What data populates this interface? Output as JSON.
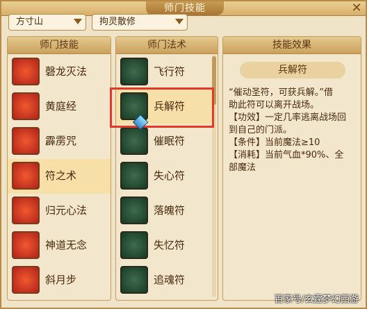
{
  "window": {
    "title": "师门技能",
    "close_label": "✕"
  },
  "filters": {
    "sect_value": "方寸山",
    "subskill_value": "拘灵散修"
  },
  "skills_panel": {
    "header": "师门技能",
    "items": [
      {
        "label": "磬龙灭法",
        "icon": "dragon-seal-icon"
      },
      {
        "label": "黄庭经",
        "icon": "book-icon"
      },
      {
        "label": "霹雳咒",
        "icon": "thunder-icon"
      },
      {
        "label": "符之术",
        "icon": "talisman-icon",
        "selected": true
      },
      {
        "label": "归元心法",
        "icon": "core-icon"
      },
      {
        "label": "神道无念",
        "icon": "shrine-icon"
      },
      {
        "label": "斜月步",
        "icon": "crescent-step-icon"
      }
    ]
  },
  "spells_panel": {
    "header": "师门法术",
    "items": [
      {
        "label": "飞行符",
        "icon": "flight-talisman-icon"
      },
      {
        "label": "兵解符",
        "icon": "escape-talisman-icon",
        "selected": true
      },
      {
        "label": "催眠符",
        "icon": "sleep-talisman-icon"
      },
      {
        "label": "失心符",
        "icon": "mind-talisman-icon"
      },
      {
        "label": "落魄符",
        "icon": "soul-talisman-icon"
      },
      {
        "label": "失忆符",
        "icon": "memory-talisman-icon"
      },
      {
        "label": "追魂符",
        "icon": "chase-talisman-icon"
      }
    ]
  },
  "effect_panel": {
    "header": "技能效果",
    "spell_name": "兵解符",
    "lines": [
      "“催动圣符，可获兵解。”借",
      "助此符可以离开战场。",
      "【功效】一定几率逃离战场回",
      "到自己的门派。",
      "【条件】当前魔法≥10",
      "【消耗】当前气血*90%、全",
      "部魔法"
    ]
  },
  "watermark": "百家号/玄霆梦幻西游"
}
